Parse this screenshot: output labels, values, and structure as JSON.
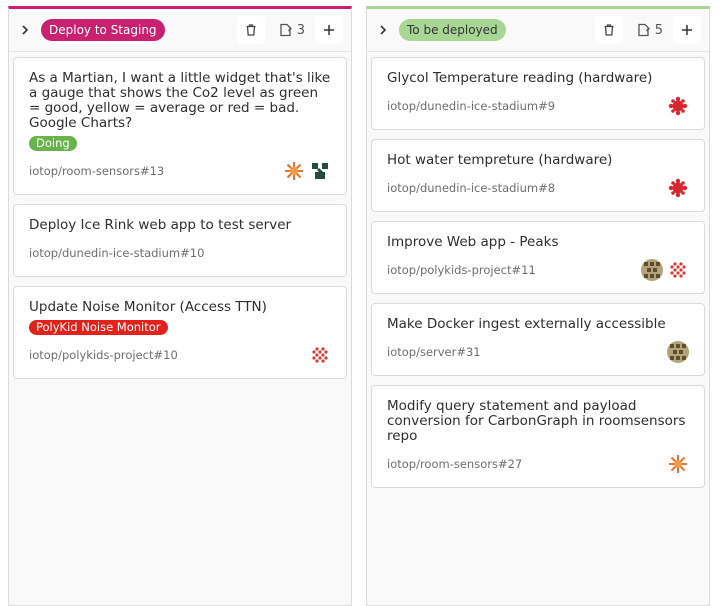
{
  "columns": [
    {
      "label": "Deploy to Staging",
      "count": "3",
      "cards": [
        {
          "title": "As a Martian, I want a little widget that's like a gauge that shows the Co2 level as green = good, yellow = average or red = bad. Google Charts?",
          "label": {
            "text": "Doing",
            "bg": "#69b34c",
            "fg": "#ffffff"
          },
          "ref": "iotop/room-sensors#13",
          "avatars": [
            "sun-orange-avatar",
            "dark-green-avatar"
          ]
        },
        {
          "title": "Deploy Ice Rink web app to test server",
          "ref": "iotop/dunedin-ice-stadium#10",
          "avatars": []
        },
        {
          "title": "Update Noise Monitor (Access TTN)",
          "label": {
            "text": "PolyKid Noise Monitor",
            "bg": "#e3211b",
            "fg": "#ffffff"
          },
          "ref": "iotop/polykids-project#10",
          "avatars": [
            "red-grid-avatar"
          ]
        }
      ]
    },
    {
      "label": "To be deployed",
      "count": "5",
      "cards": [
        {
          "title": "Glycol Temperature reading (hardware)",
          "ref": "iotop/dunedin-ice-stadium#9",
          "avatars": [
            "red-star-avatar"
          ]
        },
        {
          "title": "Hot water tempreture (hardware)",
          "ref": "iotop/dunedin-ice-stadium#8",
          "avatars": [
            "red-star-avatar"
          ]
        },
        {
          "title": "Improve Web app - Peaks",
          "ref": "iotop/polykids-project#11",
          "avatars": [
            "olive-grid-avatar",
            "red-grid-avatar"
          ]
        },
        {
          "title": "Make Docker ingest externally accessible",
          "ref": "iotop/server#31",
          "avatars": [
            "olive-grid-avatar"
          ]
        },
        {
          "title": "Modify query statement and payload conversion for CarbonGraph in roomsensors repo",
          "ref": "iotop/room-sensors#27",
          "avatars": [
            "sun-orange-avatar"
          ]
        }
      ]
    }
  ]
}
